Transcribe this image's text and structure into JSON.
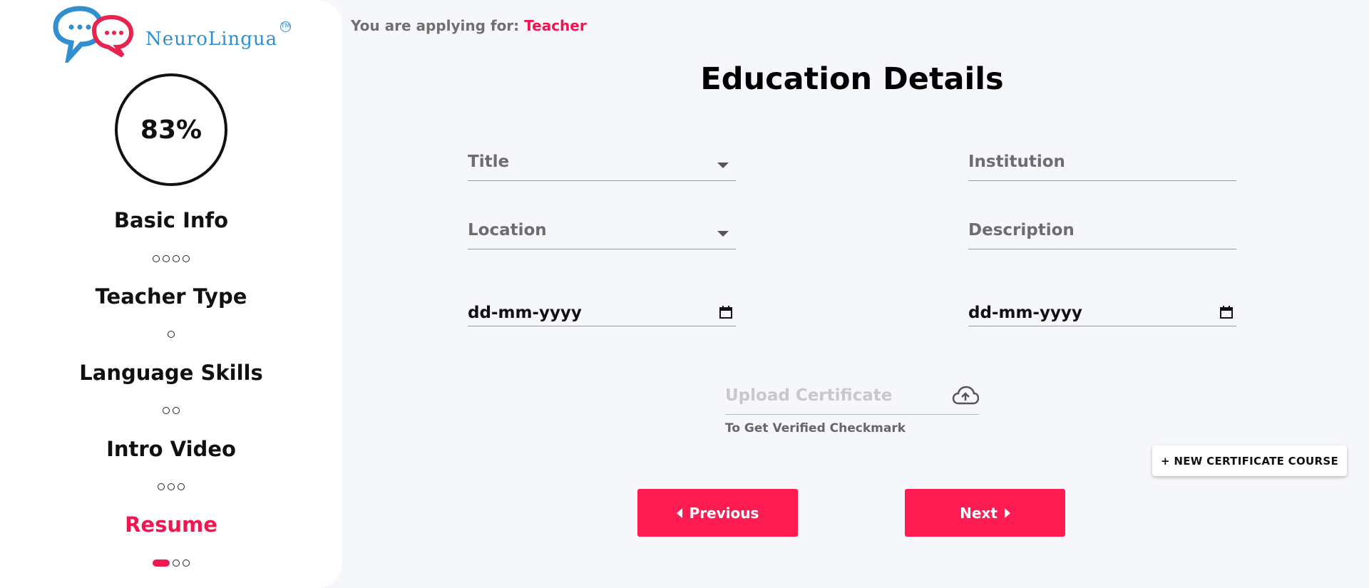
{
  "brand": {
    "name": "NeuroLingua",
    "trademark": "TM"
  },
  "progress": {
    "percent_label": "83%",
    "percent": 83
  },
  "steps": [
    {
      "label": "Basic Info",
      "dots": 4,
      "active": false
    },
    {
      "label": "Teacher Type",
      "dots": 1,
      "active": false
    },
    {
      "label": "Language Skills",
      "dots": 2,
      "active": false
    },
    {
      "label": "Intro Video",
      "dots": 3,
      "active": false
    },
    {
      "label": "Resume",
      "dots": 3,
      "active": true
    }
  ],
  "applying": {
    "prefix": "You are applying for:",
    "role": "Teacher"
  },
  "page_title": "Education Details",
  "form": {
    "title_label": "Title",
    "institution_label": "Institution",
    "location_label": "Location",
    "description_label": "Description",
    "start_date_placeholder": "dd-mm-yyyy",
    "end_date_placeholder": "dd-mm-yyyy",
    "upload_label": "Upload Certificate",
    "upload_hint": "To Get Verified Checkmark"
  },
  "buttons": {
    "new_course": "+ NEW CERTIFICATE COURSE",
    "previous": "Previous",
    "next": "Next"
  },
  "colors": {
    "accent": "#f0164f",
    "brand_blue": "#2f8fd0",
    "background": "#f6f7fb"
  },
  "icons": [
    "logo-speech-bubbles-icon",
    "chevron-down-icon",
    "calendar-icon",
    "cloud-upload-icon",
    "caret-left-icon",
    "caret-right-icon"
  ]
}
